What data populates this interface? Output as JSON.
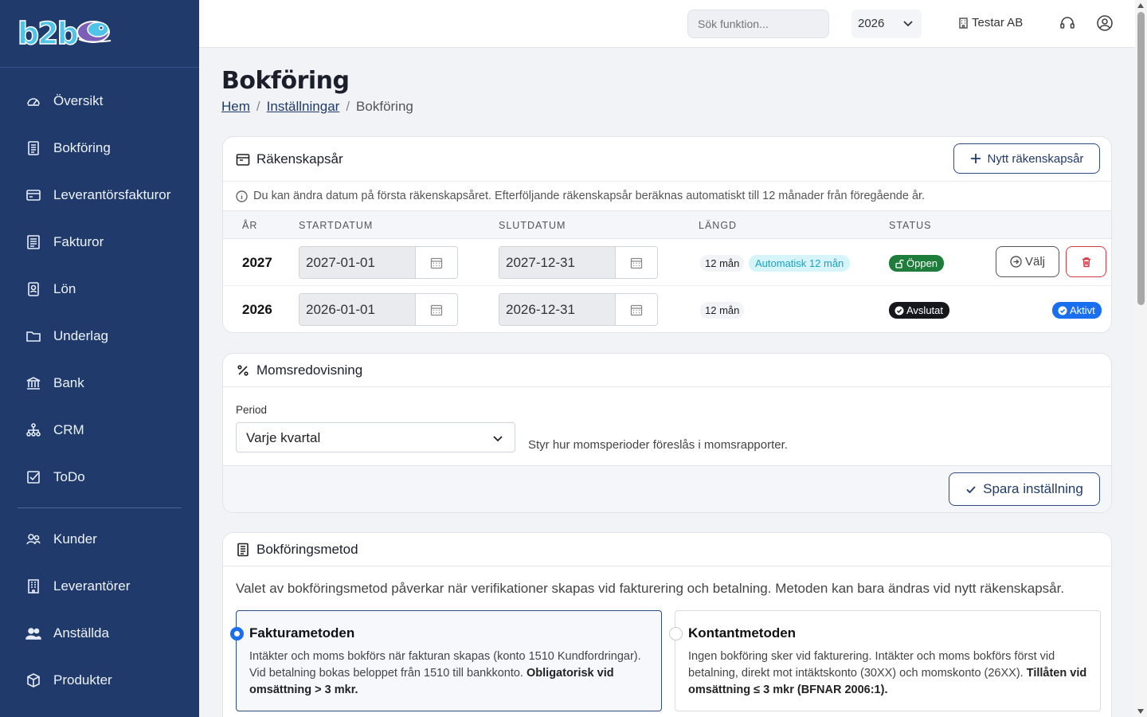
{
  "app": {
    "logo_text": "b2b"
  },
  "sidebar": {
    "items": [
      {
        "label": "Översikt",
        "icon": "gauge-icon"
      },
      {
        "label": "Bokföring",
        "icon": "ledger-icon"
      },
      {
        "label": "Leverantörsfakturor",
        "icon": "card-icon"
      },
      {
        "label": "Fakturor",
        "icon": "invoice-icon"
      },
      {
        "label": "Lön",
        "icon": "badge-icon"
      },
      {
        "label": "Underlag",
        "icon": "folder-icon"
      },
      {
        "label": "Bank",
        "icon": "bank-icon"
      },
      {
        "label": "CRM",
        "icon": "network-icon"
      },
      {
        "label": "ToDo",
        "icon": "checkbox-icon"
      }
    ],
    "items2": [
      {
        "label": "Kunder",
        "icon": "users-icon"
      },
      {
        "label": "Leverantörer",
        "icon": "building-icon"
      },
      {
        "label": "Anställda",
        "icon": "people-icon"
      },
      {
        "label": "Produkter",
        "icon": "box-icon"
      }
    ]
  },
  "topbar": {
    "search_placeholder": "Sök funktion...",
    "year": "2026",
    "company": "Testar AB"
  },
  "page": {
    "title": "Bokföring",
    "breadcrumb": [
      "Hem",
      "Inställningar",
      "Bokföring"
    ]
  },
  "fiscal": {
    "title": "Räkenskapsår",
    "new_button": "Nytt räkenskapsår",
    "info": "Du kan ändra datum på första räkenskapsåret. Efterföljande räkenskapsår beräknas automatiskt till 12 månader från föregående år.",
    "columns": [
      "ÅR",
      "STARTDATUM",
      "SLUTDATUM",
      "LÄNGD",
      "STATUS"
    ],
    "rows": [
      {
        "year": "2027",
        "start": "2027-01-01",
        "end": "2027-12-31",
        "length": "12 mån",
        "auto": "Automatisk 12 mån",
        "status": "Öppen",
        "action": "Välj"
      },
      {
        "year": "2026",
        "start": "2026-01-01",
        "end": "2026-12-31",
        "length": "12 mån",
        "status": "Avslutat",
        "active": "Aktivt"
      }
    ]
  },
  "vat": {
    "title": "Momsredovisning",
    "period_label": "Period",
    "period_value": "Varje kvartal",
    "hint": "Styr hur momsperioder föreslås i momsrapporter.",
    "save_button": "Spara inställning"
  },
  "method": {
    "title": "Bokföringsmetod",
    "description": "Valet av bokföringsmetod påverkar när verifikationer skapas vid fakturering och betalning. Metoden kan bara ändras vid nytt räkenskapsår.",
    "options": [
      {
        "title": "Fakturametoden",
        "text": "Intäkter och moms bokförs när fakturan skapas (konto 1510 Kundfordringar). Vid betalning bokas beloppet från 1510 till bankkonto.",
        "bold": "Obligatorisk vid omsättning > 3 mkr.",
        "selected": true
      },
      {
        "title": "Kontantmetoden",
        "text": "Ingen bokföring sker vid fakturering. Intäkter och moms bokförs först vid betalning, direkt mot intäktskonto (30XX) och momskonto (26XX).",
        "bold": "Tillåten vid omsättning ≤ 3 mkr (BFNAR 2006:1).",
        "selected": false
      }
    ]
  },
  "colors": {
    "sidebar": "#1f3a6b",
    "accent": "#1a6ef0",
    "open": "#1e7d3a",
    "danger": "#d43a46"
  }
}
